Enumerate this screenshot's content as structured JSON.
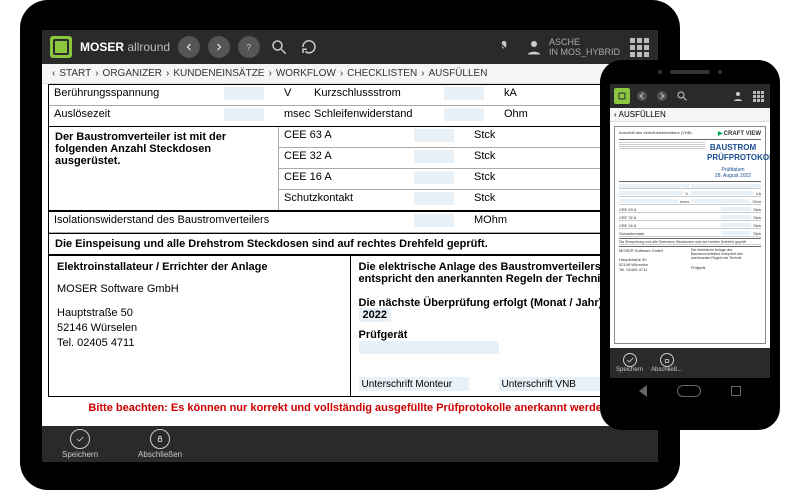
{
  "app": {
    "name": "MOSER",
    "suffix": "allround"
  },
  "user": {
    "line1": "ASCHE",
    "line2": "IN MOS_HYBRID"
  },
  "breadcrumb": [
    "START",
    "ORGANIZER",
    "KUNDENEINSÄTZE",
    "WORKFLOW",
    "CHECKLISTEN",
    "AUSFÜLLEN"
  ],
  "form": {
    "rowsTop": [
      {
        "l": "Berührungsspannung",
        "u1": "V",
        "m": "Kurzschlussstrom",
        "u2": "kA"
      },
      {
        "l": "Auslösezeit",
        "u1": "msec",
        "m": "Schleifenwiderstand",
        "u2": "Ohm"
      }
    ],
    "socketTitle": "Der Baustromverteiler ist mit der folgenden Anzahl Steckdosen ausgerüstet.",
    "sockets": [
      {
        "name": "CEE 63 A",
        "unit": "Stck"
      },
      {
        "name": "CEE 32 A",
        "unit": "Stck"
      },
      {
        "name": "CEE 16 A",
        "unit": "Stck"
      },
      {
        "name": "Schutzkontakt",
        "unit": "Stck"
      }
    ],
    "isolation": {
      "label": "Isolationswiderstand des Baustromverteilers",
      "unit": "MOhm"
    },
    "drehfeld": "Die Einspeisung und alle Drehstrom Steckdosen sind auf rechtes Drehfeld geprüft.",
    "installer": {
      "title": "Elektroinstallateur / Errichter der Anlage",
      "name": "MOSER Software GmbH",
      "street": "Hauptstraße 50",
      "city": "52146 Würselen",
      "tel": "Tel. 02405 4711"
    },
    "right": {
      "conform": "Die elektrische Anlage des Baustromverteilers entspricht den anerkannten Regeln der Technik.",
      "next": "Die nächste Überprüfung erfolgt (Monat / Jahr)",
      "year": "2022",
      "device": "Prüfgerät",
      "sig1": "Unterschrift Monteur",
      "sig2": "Unterschrift VNB"
    },
    "notice": "Bitte beachten: Es können nur korrekt und vollständig ausgefüllte Prüfprotokolle anerkannt werden."
  },
  "bottombar": {
    "save": "Speichern",
    "finish": "Abschließen"
  },
  "phone": {
    "breadcrumb": "AUSFÜLLEN",
    "doc": {
      "brand": "CRAFT VIEW",
      "title1": "BAUSTROM",
      "title2": "PRÜFPROTOKOLL",
      "dateLabel": "Prüfdatum",
      "date": "28. August 2022",
      "vnb": "Anschrift des Verteilnetzbetreibers (VNB)",
      "company": "MOSER Software GmbH",
      "street": "Hauptstraße 50",
      "city": "52146 Würselen",
      "tel": "Tel. 02405 4711"
    },
    "bottombar": {
      "save": "Speichern",
      "finish": "Abschließ..."
    }
  },
  "chart_data": null
}
